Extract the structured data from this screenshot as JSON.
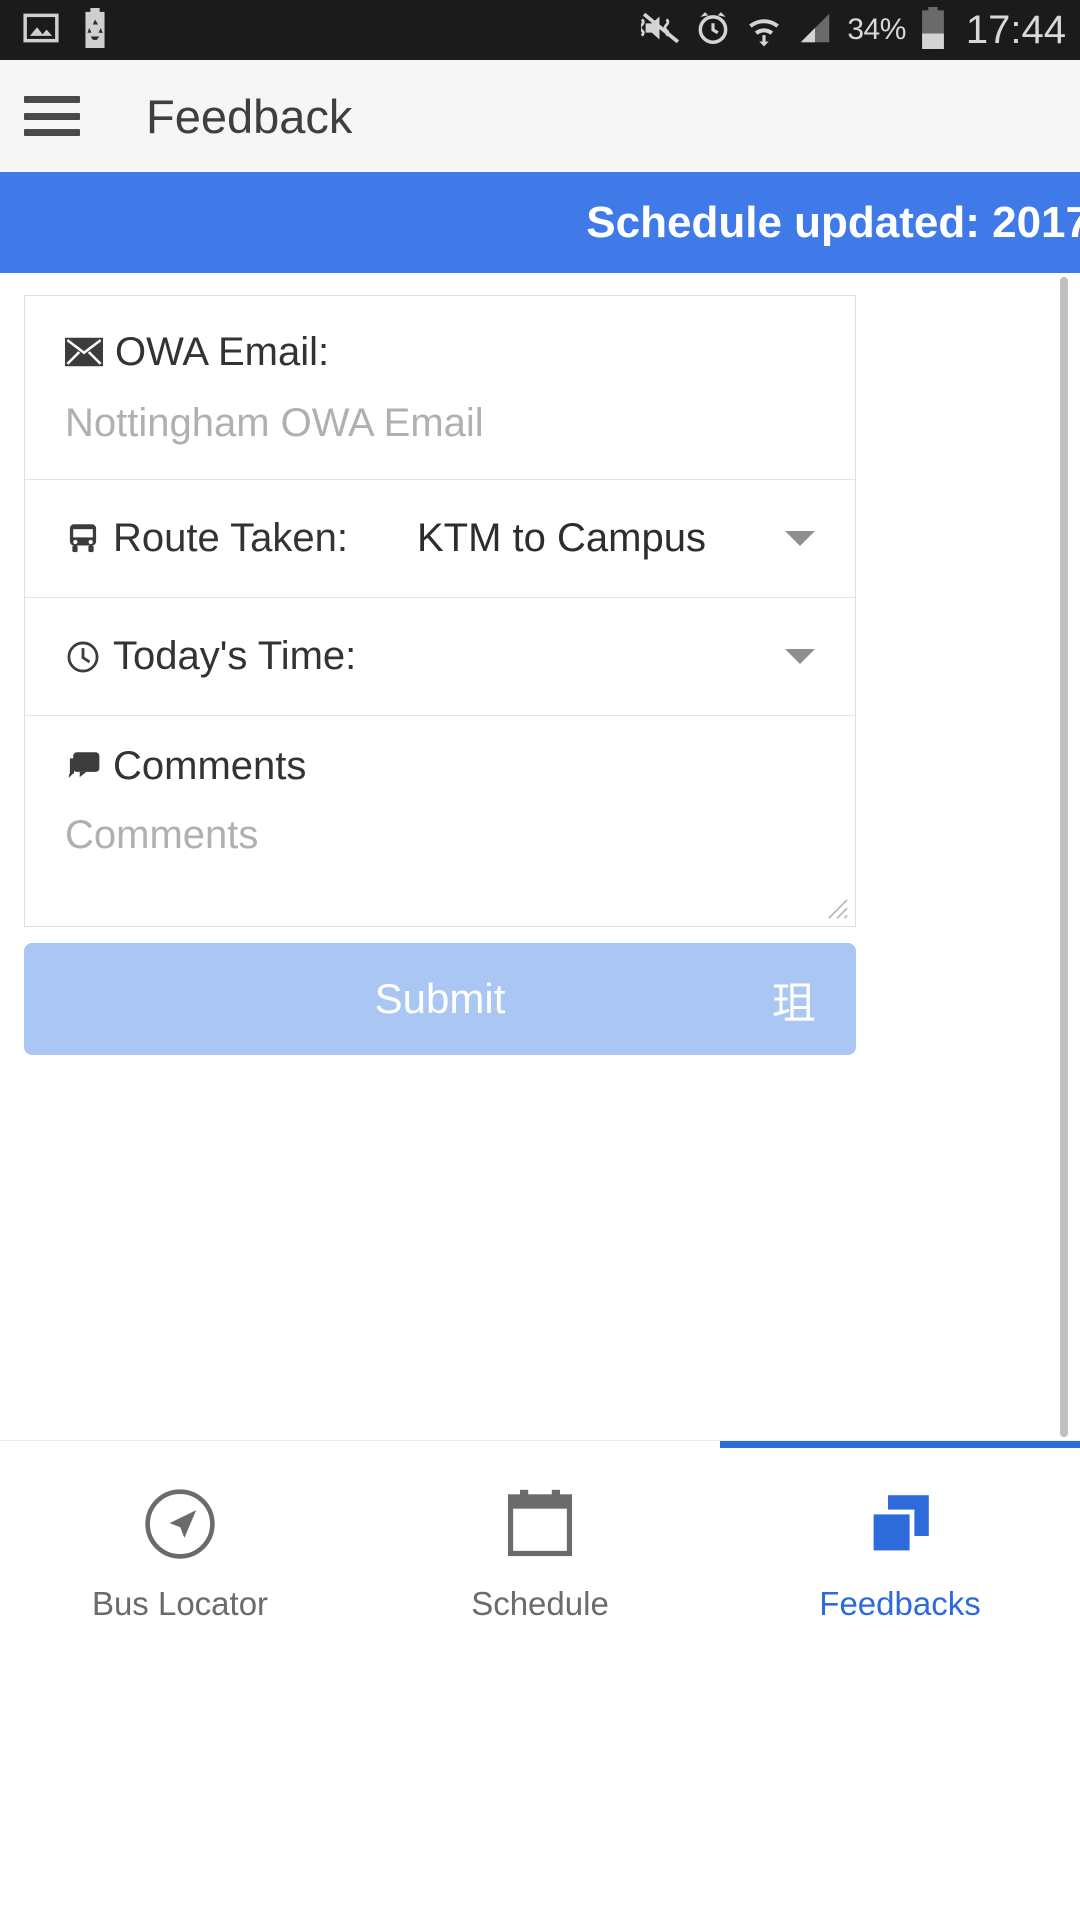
{
  "statusbar": {
    "left_icons": [
      "image-icon",
      "power-saving-battery-icon"
    ],
    "right_icons": [
      "vibrate-mute-icon",
      "alarm-icon",
      "wifi-data-icon",
      "signal-icon",
      "battery-icon"
    ],
    "battery_percent": "34%",
    "clock": "17:44"
  },
  "appbar": {
    "menu_icon": "hamburger-menu-icon",
    "title": "Feedback"
  },
  "banner": {
    "text": "Schedule updated: 2017",
    "bg_color": "#3f7ae8",
    "text_color": "#ffffff"
  },
  "form": {
    "email": {
      "icon": "envelope-icon",
      "label": "OWA Email:",
      "value": "",
      "placeholder": "Nottingham OWA Email"
    },
    "route": {
      "icon": "bus-icon",
      "label": "Route Taken:",
      "value": "KTM to Campus",
      "caret": "chevron-down-icon"
    },
    "time": {
      "icon": "clock-icon",
      "label": "Today's Time:",
      "value": "",
      "caret": "chevron-down-icon"
    },
    "comments": {
      "icon": "comment-bubble-icon",
      "label": "Comments",
      "value": "",
      "placeholder": "Comments"
    }
  },
  "submit": {
    "label": "Submit",
    "glyph": "珇",
    "bg_color": "#aac7f4"
  },
  "bottomnav": {
    "items": [
      {
        "icon": "navigation-arrow-icon",
        "label": "Bus Locator",
        "active": false
      },
      {
        "icon": "calendar-icon",
        "label": "Schedule",
        "active": false
      },
      {
        "icon": "feedback-layers-icon",
        "label": "Feedbacks",
        "active": true
      }
    ],
    "active_color": "#2f6ada"
  }
}
